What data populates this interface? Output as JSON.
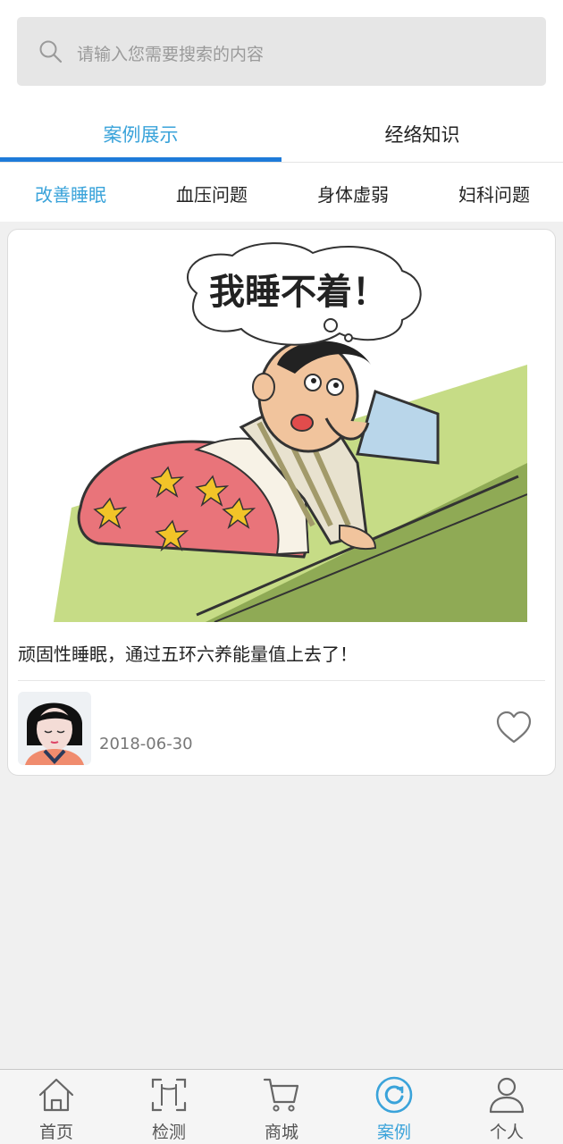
{
  "search": {
    "placeholder": "请输入您需要搜索的内容",
    "icon": "search-icon"
  },
  "main_tabs": [
    {
      "label": "案例展示",
      "active": true
    },
    {
      "label": "经络知识",
      "active": false
    }
  ],
  "sub_tabs": [
    {
      "label": "改善睡眠",
      "active": true
    },
    {
      "label": "血压问题",
      "active": false
    },
    {
      "label": "身体虚弱",
      "active": false
    },
    {
      "label": "妇科问题",
      "active": false
    }
  ],
  "case_card": {
    "image": {
      "caption_text": "我睡不着！"
    },
    "title": "顽固性睡眠，通过五环六养能量值上去了！",
    "date": "2018-06-30",
    "favorite_icon": "heart-icon"
  },
  "bottom_nav": [
    {
      "label": "首页",
      "icon": "home-icon",
      "active": false
    },
    {
      "label": "检测",
      "icon": "scan-icon",
      "active": false
    },
    {
      "label": "商城",
      "icon": "cart-icon",
      "active": false
    },
    {
      "label": "案例",
      "icon": "case-icon",
      "active": true
    },
    {
      "label": "个人",
      "icon": "person-icon",
      "active": false
    }
  ],
  "colors": {
    "accent": "#3aa3da",
    "tab_underline": "#1e7bd9",
    "background": "#f0f0f0",
    "search_bg": "#e6e6e6"
  }
}
